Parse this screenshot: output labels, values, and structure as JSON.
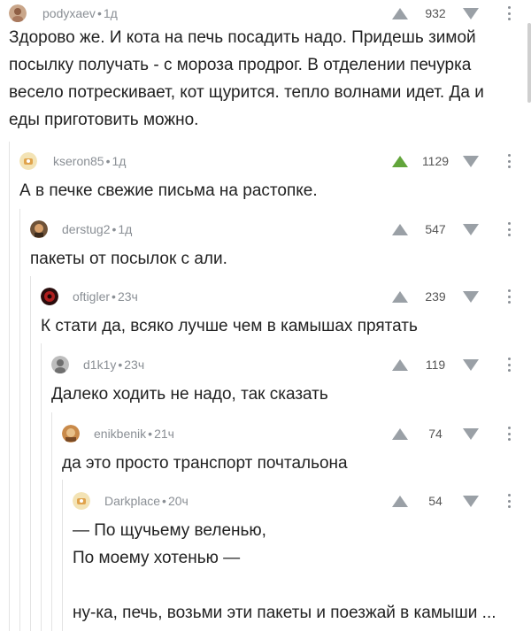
{
  "comments": [
    {
      "user": "podyxaev",
      "time": "1д",
      "score": "932",
      "text": "Здорово же. И кота на печь посадить надо. Придешь зимой посылку получать - с мороза продрог. В отделении печурка весело потрескивает, кот щурится. тепло волнами идет. Да и еды приготовить можно.",
      "upvoted": false
    },
    {
      "user": "kseron85",
      "time": "1д",
      "score": "1129",
      "text": "А в печке свежие письма на растопке.",
      "upvoted": true
    },
    {
      "user": "derstug2",
      "time": "1д",
      "score": "547",
      "text": "пакеты от посылок с али.",
      "upvoted": false
    },
    {
      "user": "oftigler",
      "time": "23ч",
      "score": "239",
      "text": "К стати да, всяко лучше чем в камышах прятать",
      "upvoted": false
    },
    {
      "user": "d1k1y",
      "time": "23ч",
      "score": "119",
      "text": "Далеко ходить не надо, так сказать",
      "upvoted": false
    },
    {
      "user": "enikbenik",
      "time": "21ч",
      "score": "74",
      "text": "да это просто транспорт почтальона",
      "upvoted": false
    },
    {
      "user": "Darkplace",
      "time": "20ч",
      "score": "54",
      "lines": [
        "— По щучьему веленью,",
        "По моему хотенью —",
        "",
        "ну-ка, печь, возьми эти пакеты и поезжай в камыши ..."
      ],
      "upvoted": false
    }
  ],
  "icons": {
    "upvote": "arrow-up-icon",
    "downvote": "arrow-down-icon",
    "more": "more-vertical-icon"
  },
  "colors": {
    "upvote_active": "#62a53b",
    "icon_gray": "#9aa0a6"
  }
}
